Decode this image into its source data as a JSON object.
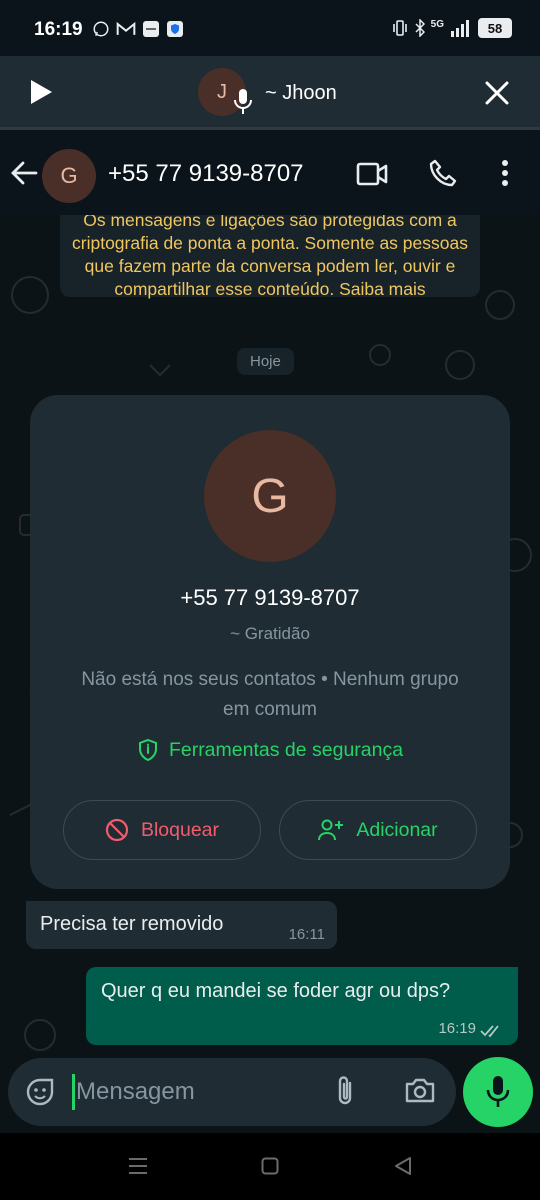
{
  "status_bar": {
    "time": "16:19",
    "network": "5G",
    "battery": "58"
  },
  "call_bar": {
    "avatar_letter": "J",
    "name": "~ Jhoon"
  },
  "header": {
    "avatar_letter": "G",
    "phone": "+55 77 9139-8707"
  },
  "chat": {
    "encryption_notice": "Os mensagens e ligações são protegidas com a criptografia de ponta a ponta. Somente as pessoas que fazem parte da conversa podem ler, ouvir e compartilhar esse conteúdo. Saiba mais",
    "day_label": "Hoje",
    "contact_card": {
      "avatar_letter": "G",
      "phone": "+55 77 9139-8707",
      "alias": "~ Gratidão",
      "info": "Não está nos seus contatos • Nenhum grupo em comum",
      "safety_tools": "Ferramentas de segurança",
      "block_label": "Bloquear",
      "add_label": "Adicionar"
    },
    "messages": [
      {
        "direction": "in",
        "text": "Precisa ter removido",
        "time": "16:11"
      },
      {
        "direction": "out",
        "text": "Quer q eu mandei se foder agr ou dps?",
        "time": "16:19",
        "status": "read"
      }
    ]
  },
  "composer": {
    "placeholder": "Mensagem"
  },
  "colors": {
    "accent": "#25d366",
    "outgoing_bubble": "#005c4b",
    "incoming_bubble": "#202c33",
    "danger": "#f15c6d",
    "notice": "#f0c75e"
  }
}
